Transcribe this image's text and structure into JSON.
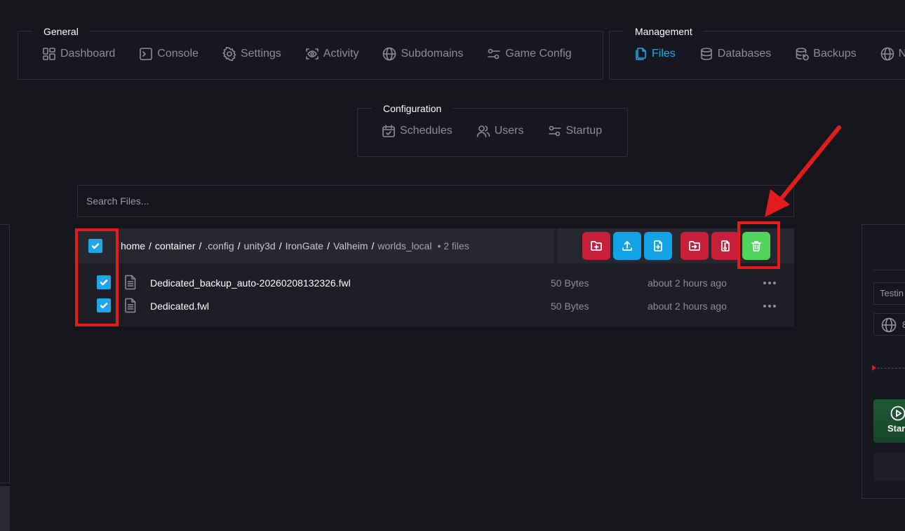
{
  "nav": {
    "general": {
      "title": "General",
      "items": [
        {
          "label": "Dashboard",
          "icon": "dashboard-icon"
        },
        {
          "label": "Console",
          "icon": "console-icon"
        },
        {
          "label": "Settings",
          "icon": "settings-icon"
        },
        {
          "label": "Activity",
          "icon": "activity-icon"
        },
        {
          "label": "Subdomains",
          "icon": "globe-icon"
        },
        {
          "label": "Game Config",
          "icon": "sliders-icon"
        }
      ]
    },
    "management": {
      "title": "Management",
      "items": [
        {
          "label": "Files",
          "icon": "files-icon",
          "active": true
        },
        {
          "label": "Databases",
          "icon": "database-icon"
        },
        {
          "label": "Backups",
          "icon": "backup-icon"
        },
        {
          "label": "N",
          "icon": "globe-icon"
        }
      ]
    },
    "configuration": {
      "title": "Configuration",
      "items": [
        {
          "label": "Schedules",
          "icon": "calendar-icon"
        },
        {
          "label": "Users",
          "icon": "users-icon"
        },
        {
          "label": "Startup",
          "icon": "sliders-icon"
        }
      ]
    }
  },
  "search": {
    "placeholder": "Search Files..."
  },
  "file_browser": {
    "breadcrumb": [
      "home",
      "container",
      ".config",
      "unity3d",
      "IronGate",
      "Valheim",
      "worlds_local"
    ],
    "separator": "/",
    "file_count": "• 2 files",
    "actions": [
      {
        "name": "new-folder",
        "icon": "folder-plus-icon",
        "color": "#c8203a"
      },
      {
        "name": "upload",
        "icon": "upload-icon",
        "color": "#12a3e6"
      },
      {
        "name": "new-file",
        "icon": "file-plus-icon",
        "color": "#12a3e6"
      },
      {
        "name": "move",
        "icon": "folder-move-icon",
        "color": "#c8203a"
      },
      {
        "name": "archive",
        "icon": "file-archive-icon",
        "color": "#c8203a"
      },
      {
        "name": "delete",
        "icon": "trash-icon",
        "color": "#4fd55b"
      }
    ],
    "files": [
      {
        "name": "Dedicated_backup_auto-20260208132326.fwl",
        "size": "50 Bytes",
        "modified": "about 2 hours ago",
        "checked": true
      },
      {
        "name": "Dedicated.fwl",
        "size": "50 Bytes",
        "modified": "about 2 hours ago",
        "checked": true
      }
    ]
  },
  "right_panel": {
    "input_value": "Testin",
    "address_value": "8",
    "start_label": "Star"
  },
  "colors": {
    "accent": "#1ea7e8",
    "danger": "#c8203a",
    "success": "#4fd55b",
    "annotation": "#e31b1b"
  }
}
